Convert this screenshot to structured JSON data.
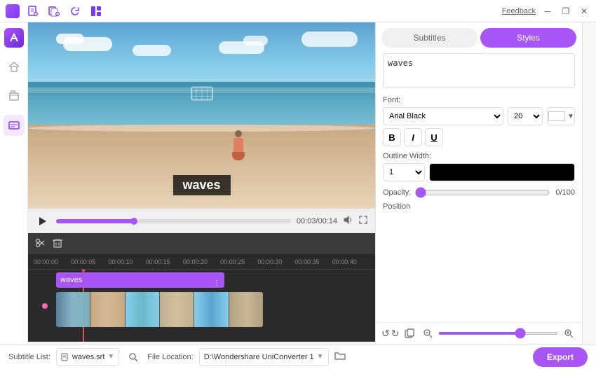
{
  "titlebar": {
    "icons": [
      "new-file",
      "new-batch",
      "refresh",
      "layout"
    ],
    "feedback": "Feedback",
    "win_minimize": "─",
    "win_restore": "❐",
    "win_close": "✕"
  },
  "sidebar": {
    "items": [
      {
        "id": "home",
        "icon": "🏠"
      },
      {
        "id": "folder",
        "icon": "📁"
      },
      {
        "id": "active",
        "icon": "📋"
      }
    ]
  },
  "video": {
    "subtitle_text": "waves",
    "time_current": "00:03",
    "time_total": "00:14"
  },
  "right_panel": {
    "tab_subtitles": "Subtitles",
    "tab_styles": "Styles",
    "active_tab": "Styles",
    "subtitle_content": "waves",
    "font_label": "Font:",
    "font_name": "Arial Black",
    "font_size": "20",
    "bold": "B",
    "italic": "I",
    "underline": "U",
    "outline_width_label": "Outline Width:",
    "outline_width_value": "1",
    "opacity_label": "Opacity:",
    "opacity_value": "0/100",
    "position_label": "Position"
  },
  "timeline": {
    "ruler_marks": [
      "00:00:00",
      "00:00:05",
      "00:00:10",
      "00:00:15",
      "00:00:20",
      "00:00:25",
      "00:00:30",
      "00:00:35",
      "00:00:40"
    ],
    "subtitle_label": "waves"
  },
  "bottom_bar": {
    "subtitle_list_label": "Subtitle List:",
    "subtitle_file": "waves.srt",
    "file_location_label": "File Location:",
    "file_path": "D:\\Wondershare UniConverter 1",
    "export_label": "Export"
  }
}
